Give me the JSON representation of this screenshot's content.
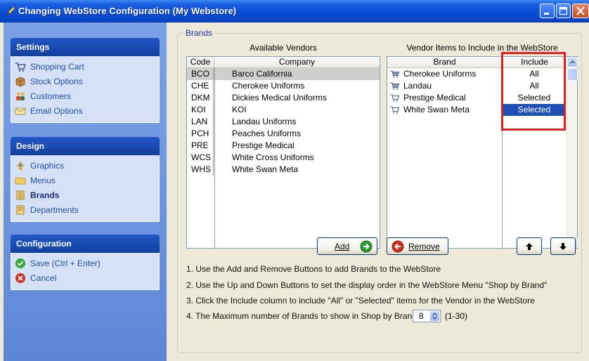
{
  "window": {
    "title": "Changing WebStore Configuration  (My Webstore)"
  },
  "sidebar": {
    "groups": [
      {
        "title": "Settings",
        "items": [
          {
            "label": "Shopping Cart",
            "icon": "shopping-cart-icon"
          },
          {
            "label": "Stock Options",
            "icon": "stock-box-icon"
          },
          {
            "label": "Customers",
            "icon": "customers-icon"
          },
          {
            "label": "Email Options",
            "icon": "email-icon"
          }
        ]
      },
      {
        "title": "Design",
        "items": [
          {
            "label": "Graphics",
            "icon": "graphics-icon"
          },
          {
            "label": "Menus",
            "icon": "folder-icon"
          },
          {
            "label": "Brands",
            "icon": "brands-icon",
            "active": true
          },
          {
            "label": "Departments",
            "icon": "departments-icon"
          }
        ]
      },
      {
        "title": "Configuration",
        "items": [
          {
            "label": "Save (Ctrl + Enter)",
            "icon": "save-check-icon"
          },
          {
            "label": "Cancel",
            "icon": "cancel-x-icon"
          }
        ]
      }
    ]
  },
  "brands": {
    "group_label": "Brands",
    "available_caption": "Available Vendors",
    "available_headers": {
      "code": "Code",
      "company": "Company"
    },
    "vendors": [
      {
        "code": "BCO",
        "company": "Barco California",
        "selected": true
      },
      {
        "code": "CHE",
        "company": "Cherokee Uniforms"
      },
      {
        "code": "DKM",
        "company": "Dickies Medical Uniforms"
      },
      {
        "code": "KOI",
        "company": "KOI"
      },
      {
        "code": "LAN",
        "company": "Landau Uniforms"
      },
      {
        "code": "PCH",
        "company": "Peaches Uniforms"
      },
      {
        "code": "PRE",
        "company": "Prestige Medical"
      },
      {
        "code": "WCS",
        "company": "White Cross Uniforms"
      },
      {
        "code": "WHS",
        "company": "White Swan Meta"
      }
    ],
    "items_caption": "Vendor Items to Include in the WebStore",
    "items_headers": {
      "brand": "Brand",
      "include": "Include"
    },
    "items": [
      {
        "brand": "Cherokee Uniforms",
        "include": "All",
        "icon": "cart-icon"
      },
      {
        "brand": "Landau",
        "include": "All",
        "icon": "cart-icon"
      },
      {
        "brand": "Prestige Medical",
        "include": "Selected",
        "icon": "cart-partial-icon"
      },
      {
        "brand": "White Swan Meta",
        "include": "Selected",
        "icon": "cart-partial-icon",
        "selected": true
      }
    ]
  },
  "buttons": {
    "add": "Add",
    "remove": "Remove"
  },
  "instructions": {
    "line1": "1. Use the Add and Remove Buttons to add Brands to the WebStore",
    "line2": "2. Use the Up and Down Buttons to set the display order in the WebStore Menu \"Shop by Brand\"",
    "line3": "3. Click the Include column to include \"All\" or \"Selected\" items for the Vendor in the WebStore",
    "line4": "4. The Maximum number of Brands to show in Shop by Brand:",
    "max_brands": "8",
    "range": "(1-30)"
  },
  "colors": {
    "title_bar": "#0a4ed6",
    "nav_background": "#6b93de",
    "selection": "#1e4fb4",
    "highlight_box": "#e0201d"
  }
}
